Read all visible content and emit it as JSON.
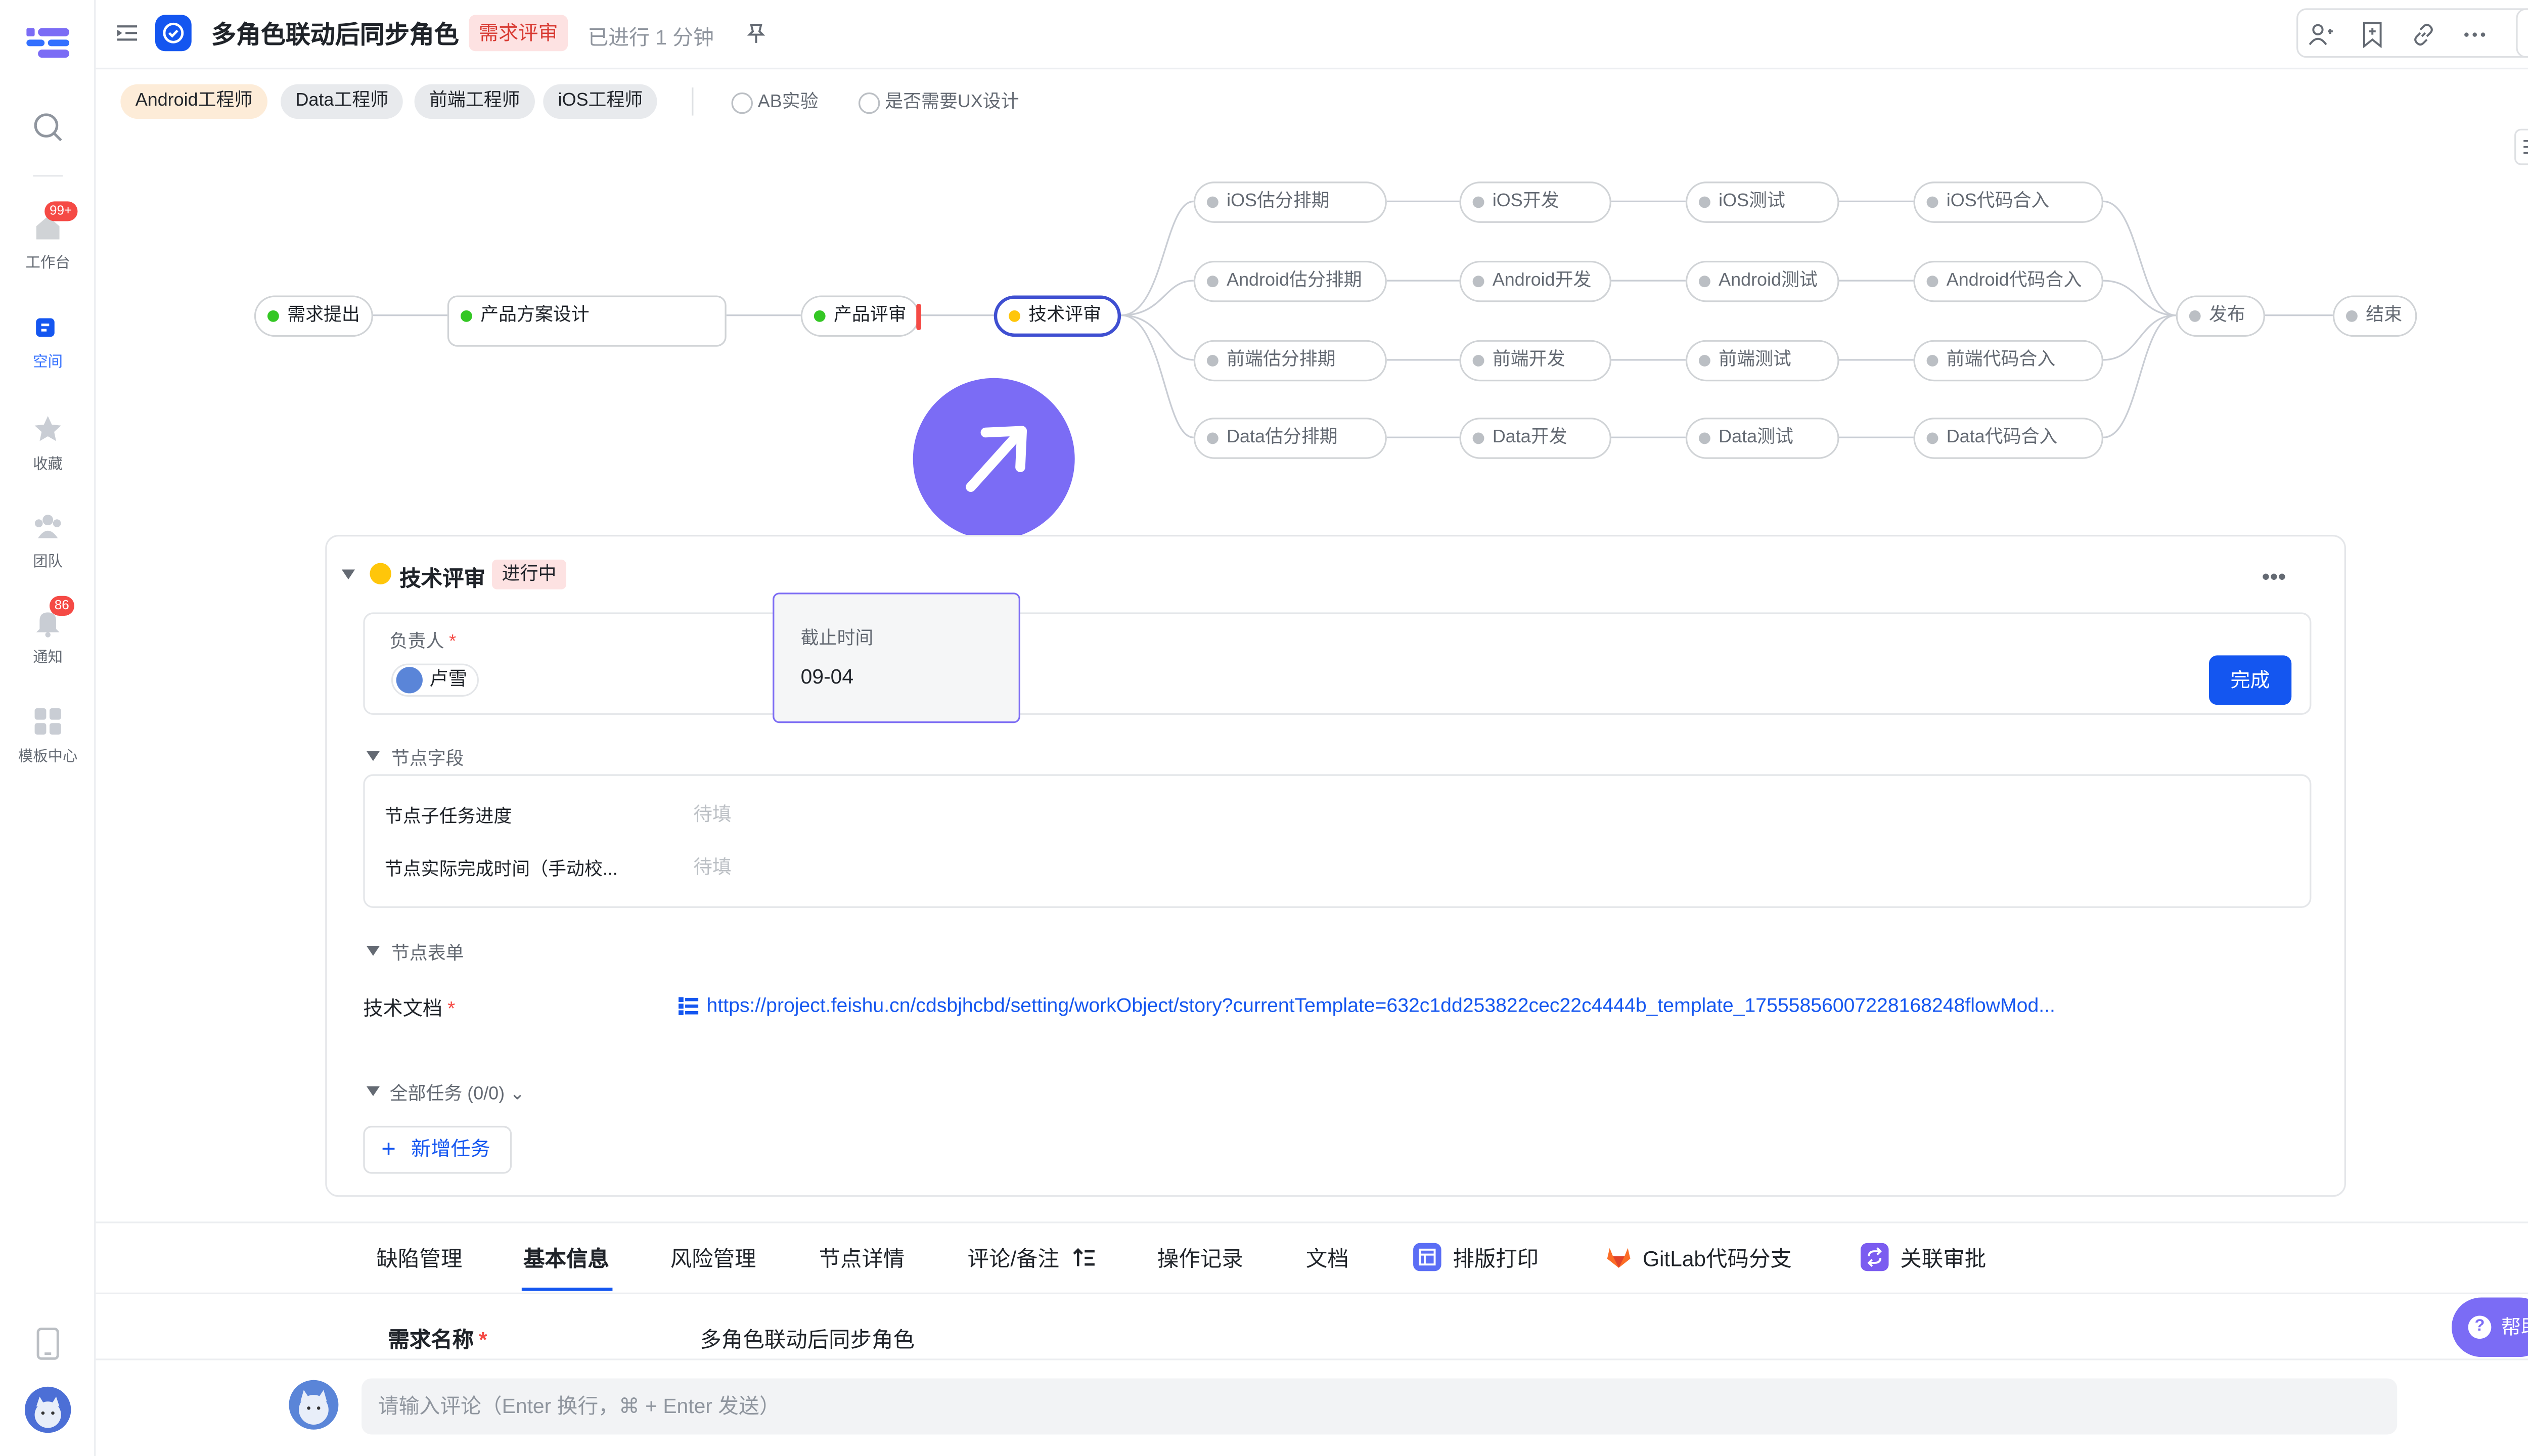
{
  "nav": {
    "items": [
      {
        "label": "工作台",
        "badge": "99+"
      },
      {
        "label": "空间",
        "active": true
      },
      {
        "label": "收藏"
      },
      {
        "label": "团队"
      },
      {
        "label": "通知",
        "badge": "86"
      },
      {
        "label": "模板中心"
      }
    ]
  },
  "header": {
    "title": "多角色联动后同步角色",
    "status": "需求评审",
    "elapsed": "已进行 1 分钟"
  },
  "roles": [
    "Android工程师",
    "Data工程师",
    "前端工程师",
    "iOS工程师"
  ],
  "options": [
    "AB实验",
    "是否需要UX设计"
  ],
  "workflow": {
    "main": [
      "需求提出",
      "产品方案设计",
      "产品评审",
      "技术评审"
    ],
    "branches": {
      "ios": [
        "iOS估分排期",
        "iOS开发",
        "iOS测试",
        "iOS代码合入"
      ],
      "android": [
        "Android估分排期",
        "Android开发",
        "Android测试",
        "Android代码合入"
      ],
      "frontend": [
        "前端估分排期",
        "前端开发",
        "前端测试",
        "前端代码合入"
      ],
      "data": [
        "Data估分排期",
        "Data开发",
        "Data测试",
        "Data代码合入"
      ]
    },
    "end": [
      "发布",
      "结束"
    ]
  },
  "panel": {
    "title": "技术评审",
    "status": "进行中",
    "owner_label": "负责人",
    "owner_name": "卢雪",
    "deadline_label": "截止时间",
    "deadline_value": "09-04",
    "done_label": "完成",
    "fields_section": "节点字段",
    "fields": [
      {
        "label": "节点子任务进度",
        "value": "待填"
      },
      {
        "label": "节点实际完成时间（手动校...",
        "value": "待填"
      }
    ],
    "form_section": "节点表单",
    "doc_label": "技术文档",
    "doc_link": "https://project.feishu.cn/cdsbjhcbd/setting/workObject/story?currentTemplate=632c1dd253822cec22c4444b_template_17555856007228168248flowMod...",
    "all_tasks": "全部任务 (0/0)",
    "new_task": "新增任务"
  },
  "tabs": [
    "缺陷管理",
    "基本信息",
    "风险管理",
    "节点详情",
    "评论/备注",
    "操作记录",
    "文档",
    "排版打印",
    "GitLab代码分支",
    "关联审批"
  ],
  "basic": {
    "label": "需求名称",
    "value": "多角色联动后同步角色"
  },
  "help": "帮助",
  "comment": {
    "placeholder": "请输入评论（Enter 换行，⌘ + Enter 发送）"
  },
  "colors": {
    "accent": "#1456f0",
    "purple": "#7b6cf5",
    "done": "#34c724",
    "current": "#ffc60a",
    "danger": "#f54a45"
  }
}
